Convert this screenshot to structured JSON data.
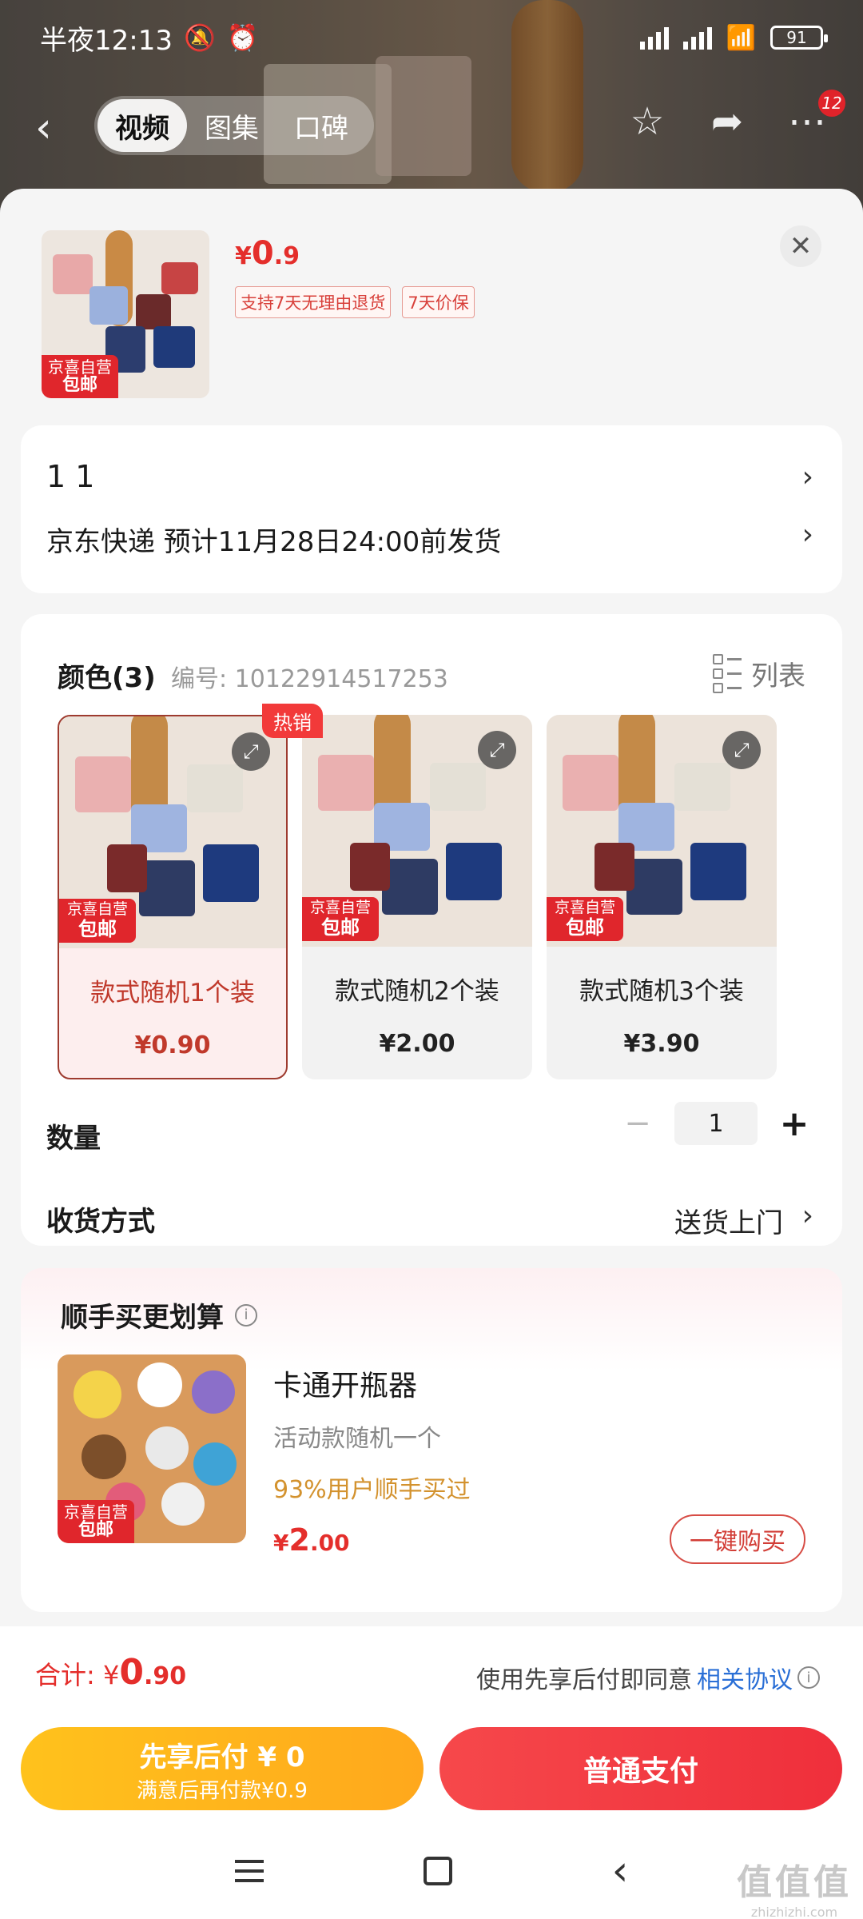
{
  "status_bar": {
    "time": "半夜12:13",
    "battery": "91"
  },
  "nav": {
    "tabs": [
      {
        "label": "视频"
      },
      {
        "label": "图集"
      },
      {
        "label": "口碑"
      }
    ],
    "cart_badge": "12"
  },
  "product": {
    "price_symbol": "¥",
    "price_int": "0",
    "price_dec": ".9",
    "policies": [
      "支持7天无理由退货",
      "7天价保"
    ],
    "tag_top": "京喜自营",
    "tag_bottom": "包邮"
  },
  "address": {
    "line1": "1 1",
    "delivery": "京东快递 预计11月28日24:00前发货"
  },
  "spec": {
    "title": "颜色(3)",
    "code": "编号: 10122914517253",
    "list_label": "列表",
    "hot_label": "热销",
    "options": [
      {
        "name": "款式随机1个装",
        "price": "¥0.90",
        "tag_top": "京喜自营",
        "tag_bottom": "包邮",
        "selected": true
      },
      {
        "name": "款式随机2个装",
        "price": "¥2.00",
        "tag_top": "京喜自营",
        "tag_bottom": "包邮",
        "selected": false
      },
      {
        "name": "款式随机3个装",
        "price": "¥3.90",
        "tag_top": "京喜自营",
        "tag_bottom": "包邮",
        "selected": false
      }
    ],
    "quantity_label": "数量",
    "quantity_value": "1",
    "shipping_label": "收货方式",
    "shipping_value": "送货上门"
  },
  "upsell": {
    "title": "顺手买更划算",
    "name": "卡通开瓶器",
    "subtitle": "活动款随机一个",
    "stat": "93%用户顺手买过",
    "price_symbol": "¥",
    "price_int": "2",
    "price_dec": ".00",
    "tag_top": "京喜自营",
    "tag_bottom": "包邮",
    "button": "一键购买"
  },
  "footer": {
    "total_label": "合计: ",
    "total_symbol": "¥",
    "total_int": "0",
    "total_dec": ".90",
    "agree_prefix": "使用先享后付即同意",
    "agree_link": "相关协议",
    "pay_later_line1": "先享后付 ¥ 0",
    "pay_later_line2": "满意后再付款¥0.9",
    "pay_normal": "普通支付"
  },
  "watermark": {
    "line1": "值值值",
    "line2": "zhizhizhi.com"
  }
}
